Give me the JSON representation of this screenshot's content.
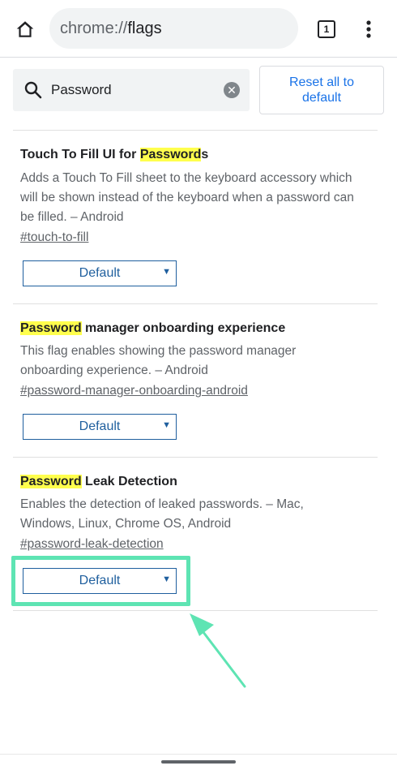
{
  "toolbar": {
    "url_scheme": "chrome://",
    "url_path": "flags",
    "tab_count": "1"
  },
  "search": {
    "value": "Password",
    "reset_label": "Reset all to default"
  },
  "flags": [
    {
      "title_before": "Touch To Fill UI for ",
      "title_highlight": "Password",
      "title_after": "s",
      "description": "Adds a Touch To Fill sheet to the keyboard accessory which will be shown instead of the keyboard when a password can be filled. – Android",
      "link": "#touch-to-fill",
      "selected": "Default"
    },
    {
      "title_before": "",
      "title_highlight": "Password",
      "title_after": " manager onboarding experience",
      "description": "This flag enables showing the password manager onboarding experience. – Android",
      "link": "#password-manager-onboarding-android",
      "selected": "Default"
    },
    {
      "title_before": "",
      "title_highlight": "Password",
      "title_after": " Leak Detection",
      "description": "Enables the detection of leaked passwords. – Mac, Windows, Linux, Chrome OS, Android",
      "link": "#password-leak-detection",
      "selected": "Default"
    }
  ],
  "colors": {
    "highlight": "#ffff4d",
    "annotation": "#5ee4b3",
    "select_blue": "#1f5f9e",
    "link_blue": "#1a73e8"
  }
}
